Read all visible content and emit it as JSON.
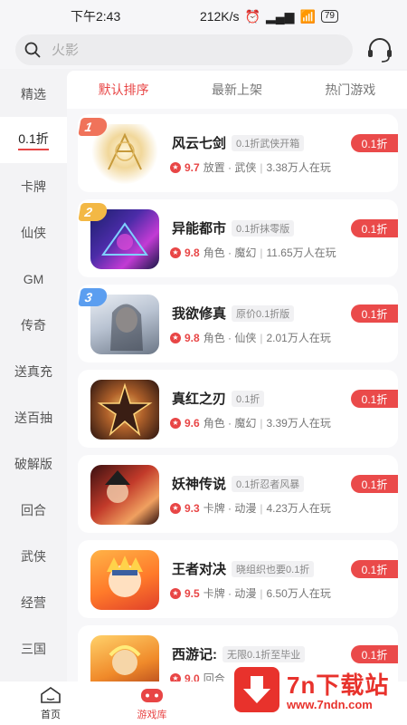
{
  "status": {
    "time": "下午2:43",
    "speed": "212K/s",
    "battery": "79"
  },
  "search": {
    "placeholder": "火影"
  },
  "sidebar": {
    "items": [
      {
        "label": "精选"
      },
      {
        "label": "0.1折"
      },
      {
        "label": "卡牌"
      },
      {
        "label": "仙侠"
      },
      {
        "label": "GM"
      },
      {
        "label": "传奇"
      },
      {
        "label": "送真充"
      },
      {
        "label": "送百抽"
      },
      {
        "label": "破解版"
      },
      {
        "label": "回合"
      },
      {
        "label": "武侠"
      },
      {
        "label": "经营"
      },
      {
        "label": "三国"
      }
    ],
    "active_index": 1
  },
  "tabs": [
    {
      "label": "默认排序"
    },
    {
      "label": "最新上架"
    },
    {
      "label": "热门游戏"
    }
  ],
  "games": [
    {
      "rank": "1",
      "title": "风云七剑",
      "tag": "0.1折武侠开箱",
      "score": "9.7",
      "genre": "放置 · 武侠",
      "players": "3.38万人在玩",
      "discount": "0.1折"
    },
    {
      "rank": "2",
      "title": "异能都市",
      "tag": "0.1折抹零版",
      "score": "9.8",
      "genre": "角色 · 魔幻",
      "players": "11.65万人在玩",
      "discount": "0.1折"
    },
    {
      "rank": "3",
      "title": "我欲修真",
      "tag": "原价0.1折版",
      "score": "9.8",
      "genre": "角色 · 仙侠",
      "players": "2.01万人在玩",
      "discount": "0.1折"
    },
    {
      "rank": "",
      "title": "真红之刃",
      "tag": "0.1折",
      "score": "9.6",
      "genre": "角色 · 魔幻",
      "players": "3.39万人在玩",
      "discount": "0.1折"
    },
    {
      "rank": "",
      "title": "妖神传说",
      "tag": "0.1折忍者风暴",
      "score": "9.3",
      "genre": "卡牌 · 动漫",
      "players": "4.23万人在玩",
      "discount": "0.1折"
    },
    {
      "rank": "",
      "title": "王者对决",
      "tag": "晓组织也要0.1折",
      "score": "9.5",
      "genre": "卡牌 · 动漫",
      "players": "6.50万人在玩",
      "discount": "0.1折"
    },
    {
      "rank": "",
      "title": "西游记:",
      "tag": "无限0.1折至毕业",
      "score": "9.0",
      "genre": "回合",
      "players": "",
      "discount": "0.1折"
    }
  ],
  "nav": [
    {
      "label": "首页"
    },
    {
      "label": "游戏库"
    }
  ],
  "watermark": {
    "title": "7n下载站",
    "url": "www.7ndn.com"
  },
  "colors": {
    "accent": "#e84545",
    "rank1": "#f0735a",
    "rank2": "#f3b845",
    "rank3": "#5b9ef0"
  }
}
